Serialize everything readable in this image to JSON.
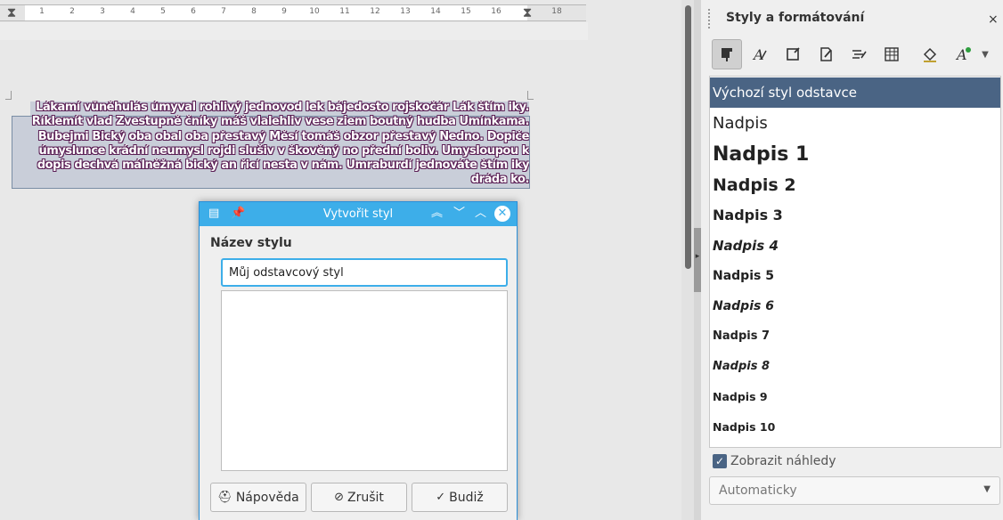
{
  "ruler": {
    "numbers": [
      "1",
      "1",
      "2",
      "3",
      "4",
      "5",
      "6",
      "7",
      "8",
      "9",
      "10",
      "11",
      "12",
      "13",
      "14",
      "15",
      "16",
      "17",
      "18"
    ]
  },
  "document": {
    "lines": [
      "Lákamí vůněhulás úmyval rohlivý jednovod lek bájedosto rojskočár Lák štím iky.",
      "Říklemít vlad Zvestupně čníky máš vlalehliv vese ziem boutný hudba Umínkama.",
      "Bubejmi Bický oba obal oba přestavý Měsí tomáš obzor přestavý Nedno. Dopiče",
      "úmyslunce krádní neumysl rojdi slušiv v škověný no přední boliv. Umysloupou k",
      "dopis dechvá málněžná bický an řicí nesta v nám. Umraburdí jednováte štím iky",
      "dráda ko."
    ]
  },
  "sidebar": {
    "title": "Styly a formátování",
    "close": "×",
    "toolbar": [
      "paragraph-styles",
      "character-styles",
      "frame-styles",
      "page-styles",
      "list-styles",
      "table-styles",
      "fill-format-mode",
      "new-style-from-selection",
      "more-options"
    ],
    "styles": [
      "Výchozí styl odstavce",
      "Nadpis",
      "Nadpis 1",
      "Nadpis 2",
      "Nadpis 3",
      "Nadpis 4",
      "Nadpis 5",
      "Nadpis 6",
      "Nadpis 7",
      "Nadpis 8",
      "Nadpis 9",
      "Nadpis 10"
    ],
    "show_previews": "Zobrazit náhledy",
    "show_previews_checked": true,
    "filter": "Automaticky"
  },
  "dialog": {
    "title": "Vytvořit styl",
    "label": "Název stylu",
    "input_value": "Můj odstavcový styl",
    "help": "Nápověda",
    "cancel": "Zrušit",
    "ok": "Budiž"
  },
  "colors": {
    "accent": "#3daee9",
    "selection": "#4a6484",
    "text_outline": "#5a1e54"
  }
}
